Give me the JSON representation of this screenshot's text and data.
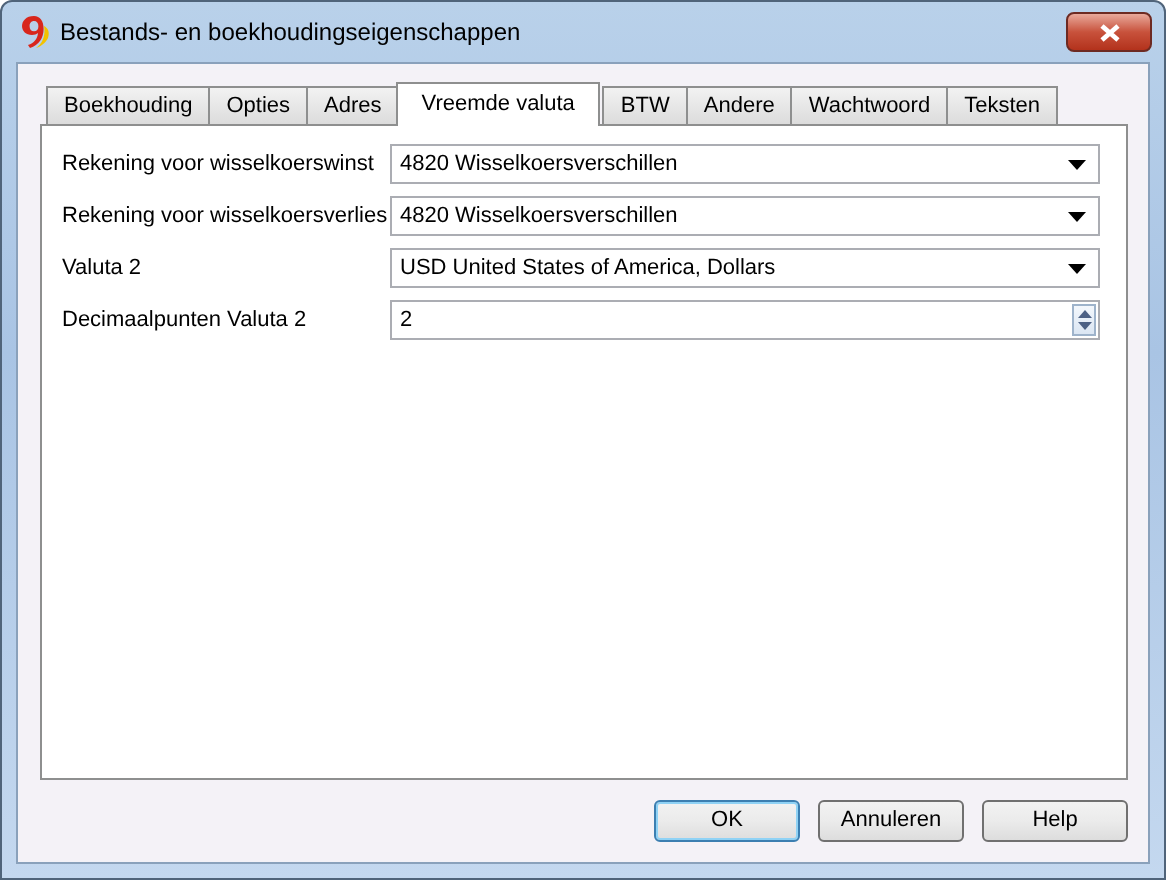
{
  "window": {
    "title": "Bestands- en boekhoudingseigenschappen"
  },
  "tabs": [
    {
      "label": "Boekhouding",
      "selected": false
    },
    {
      "label": "Opties",
      "selected": false
    },
    {
      "label": "Adres",
      "selected": false
    },
    {
      "label": "Vreemde valuta",
      "selected": true
    },
    {
      "label": "BTW",
      "selected": false
    },
    {
      "label": "Andere",
      "selected": false
    },
    {
      "label": "Wachtwoord",
      "selected": false
    },
    {
      "label": "Teksten",
      "selected": false
    }
  ],
  "fields": [
    {
      "label": "Rekening voor wisselkoerswinst",
      "kind": "select",
      "value": "4820 Wisselkoersverschillen"
    },
    {
      "label": "Rekening voor wisselkoersverlies",
      "kind": "select",
      "value": "4820 Wisselkoersverschillen"
    },
    {
      "label": "Valuta 2",
      "kind": "select",
      "value": "USD United States of America, Dollars"
    },
    {
      "label": "Decimaalpunten Valuta 2",
      "kind": "spin",
      "value": "2"
    }
  ],
  "buttons": [
    {
      "label": "OK",
      "default": true
    },
    {
      "label": "Annuleren",
      "default": false
    },
    {
      "label": "Help",
      "default": false
    }
  ]
}
